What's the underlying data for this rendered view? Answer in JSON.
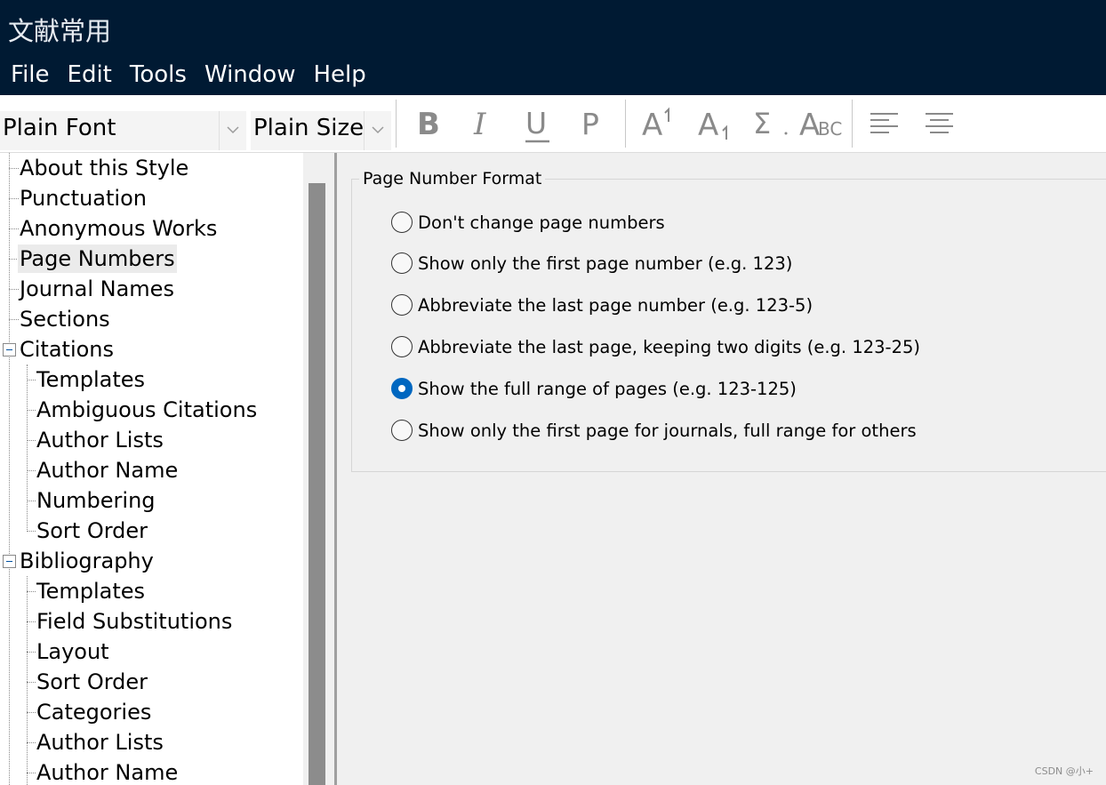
{
  "window": {
    "title": "文献常用"
  },
  "menu": [
    "File",
    "Edit",
    "Tools",
    "Window",
    "Help"
  ],
  "toolbar": {
    "font_combo": "Plain Font",
    "size_combo": "Plain Size",
    "buttons": {
      "bold": "B",
      "italic": "I",
      "underline": "U",
      "plain": "P",
      "superscript": "A",
      "subscript": "A",
      "symbol": "Σ",
      "smallcaps_big": "A",
      "smallcaps_small": "BC"
    }
  },
  "tree": {
    "items": [
      "About this Style",
      "Punctuation",
      "Anonymous Works",
      "Page Numbers",
      "Journal Names",
      "Sections",
      "Citations",
      "Templates",
      "Ambiguous Citations",
      "Author Lists",
      "Author Name",
      "Numbering",
      "Sort Order",
      "Bibliography",
      "Templates",
      "Field Substitutions",
      "Layout",
      "Sort Order",
      "Categories",
      "Author Lists",
      "Author Name"
    ],
    "selected": "Page Numbers"
  },
  "page_number_format": {
    "title": "Page Number Format",
    "options": [
      "Don't change page numbers",
      "Show only the first page number (e.g. 123)",
      "Abbreviate the last page number (e.g. 123-5)",
      "Abbreviate the last page, keeping two digits (e.g. 123-25)",
      "Show the full range of pages (e.g. 123-125)",
      "Show only the first page for journals, full range for others"
    ],
    "selected_index": 4
  },
  "watermark": "CSDN @小+",
  "colors": {
    "title_bar": "#001a33",
    "radio_selected": "#0067c0",
    "toolbar_icons": "#8a8a8a"
  }
}
